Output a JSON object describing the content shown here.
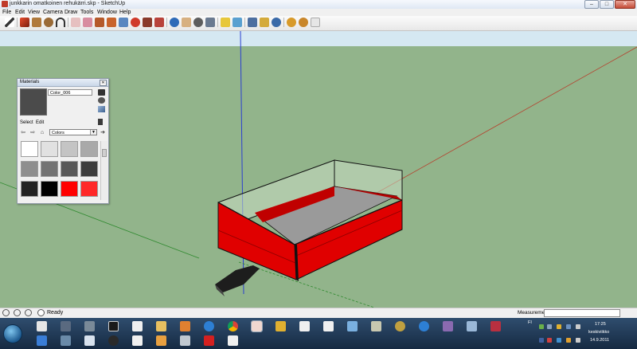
{
  "window": {
    "title": "junkkarin omatkoinen rehukärri.skp - SketchUp",
    "buttons": {
      "minimize": "–",
      "maximize": "□",
      "close": "✕"
    }
  },
  "menu": [
    "File",
    "Edit",
    "View",
    "Camera",
    "Draw",
    "Tools",
    "Window",
    "Help"
  ],
  "toolbar_icons": [
    "select-icon",
    "pencil-icon",
    "rectangle-icon",
    "circle-icon",
    "arc-icon",
    "eraser-icon",
    "paint-bucket-icon",
    "push-pull-icon",
    "move-icon",
    "rotate-icon",
    "follow-me-icon",
    "scale-icon",
    "offset-icon",
    "orbit-icon",
    "pan-icon",
    "zoom-icon",
    "zoom-extents-icon",
    "tape-measure-icon",
    "protractor-icon",
    "axes-icon",
    "dimension-icon",
    "text-icon",
    "3d-text-icon",
    "section-plane-icon",
    "walk-icon",
    "look-around-icon",
    "position-camera-icon",
    "components-icon",
    "warehouse-icon",
    "extension-icon"
  ],
  "materials_panel": {
    "title": "Materials",
    "material_name": "Color_006",
    "tabs": {
      "select": "Select",
      "edit": "Edit"
    },
    "library": "Colors",
    "swatch_colors": [
      "#ffffff",
      "#e1e1e1",
      "#c4c4c4",
      "#a9a9a9",
      "#8e8e8e",
      "#737373",
      "#585858",
      "#3d3d3d",
      "#222222",
      "#000000",
      "#ff0000",
      "#ff2828"
    ],
    "preview_color": "#4b4b4b"
  },
  "status": {
    "text": "Ready",
    "measurements_label": "Measurements"
  },
  "taskbar": {
    "language": "FI",
    "time": "17:25",
    "weekday": "keskiviikko",
    "date": "14.9.2011"
  },
  "colors": {
    "ground": "#92b48b",
    "sky": "#d5e8f2",
    "trailer_red": "#e00000",
    "trailer_floor": "#8a8a8a",
    "glass": "#c8dcc4"
  }
}
